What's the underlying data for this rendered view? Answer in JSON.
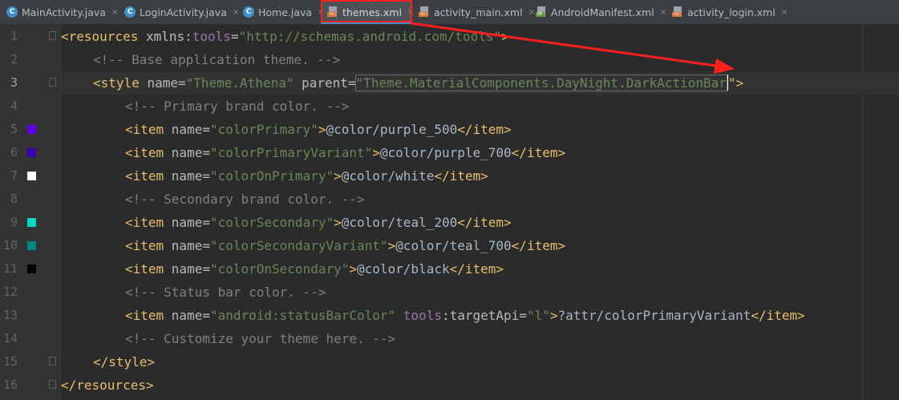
{
  "tabs": [
    {
      "label": "MainActivity.java",
      "icon": "java-class-icon",
      "active": false
    },
    {
      "label": "LoginActivity.java",
      "icon": "java-class-icon",
      "active": false
    },
    {
      "label": "Home.java",
      "icon": "java-class-icon",
      "active": false
    },
    {
      "label": "themes.xml",
      "icon": "xml-file-icon",
      "active": true
    },
    {
      "label": "activity_main.xml",
      "icon": "xml-file-icon",
      "active": false
    },
    {
      "label": "AndroidManifest.xml",
      "icon": "manifest-file-icon",
      "active": false
    },
    {
      "label": "activity_login.xml",
      "icon": "xml-file-icon",
      "active": false
    }
  ],
  "tab_close_glyph": "×",
  "java_icon_letter": "C",
  "xml_icon_tag": "<>",
  "manifest_icon_tag": "MF",
  "editor": {
    "current_line": 3,
    "line_numbers": [
      "1",
      "2",
      "3",
      "4",
      "5",
      "6",
      "7",
      "8",
      "9",
      "10",
      "11",
      "12",
      "13",
      "14",
      "15",
      "16"
    ],
    "swatches": [
      {
        "line": 5,
        "color": "#6200ee"
      },
      {
        "line": 6,
        "color": "#3700b3"
      },
      {
        "line": 7,
        "color": "#ffffff"
      },
      {
        "line": 9,
        "color": "#03dac5"
      },
      {
        "line": 10,
        "color": "#018786"
      },
      {
        "line": 11,
        "color": "#000000"
      }
    ],
    "lines": {
      "l1": {
        "open": "<resources ",
        "ns_attr": "xmlns:",
        "ns_name": "tools",
        "eq": "=",
        "value": "\"http://schemas.android.com/tools\"",
        "close": ">"
      },
      "l2": {
        "comment": "<!-- Base application theme. -->"
      },
      "l3": {
        "open": "<style ",
        "attr1": "name",
        "eq1": "=",
        "val1": "\"Theme.Athena\"",
        "attr2": "parent",
        "eq2": "=",
        "val2_a": "\"Theme.MaterialComponents.DayNight.DarkActionBar",
        "val2_b": "\"",
        "close": ">"
      },
      "l4": {
        "comment": "<!-- Primary brand color. -->"
      },
      "l5": {
        "open": "<item ",
        "attr": "name",
        "eq": "=",
        "value": "\"colorPrimary\"",
        "gt": ">",
        "text": "@color/purple_500",
        "close": "</item>"
      },
      "l6": {
        "open": "<item ",
        "attr": "name",
        "eq": "=",
        "value": "\"colorPrimaryVariant\"",
        "gt": ">",
        "text": "@color/purple_700",
        "close": "</item>"
      },
      "l7": {
        "open": "<item ",
        "attr": "name",
        "eq": "=",
        "value": "\"colorOnPrimary\"",
        "gt": ">",
        "text": "@color/white",
        "close": "</item>"
      },
      "l8": {
        "comment": "<!-- Secondary brand color. -->"
      },
      "l9": {
        "open": "<item ",
        "attr": "name",
        "eq": "=",
        "value": "\"colorSecondary\"",
        "gt": ">",
        "text": "@color/teal_200",
        "close": "</item>"
      },
      "l10": {
        "open": "<item ",
        "attr": "name",
        "eq": "=",
        "value": "\"colorSecondaryVariant\"",
        "gt": ">",
        "text": "@color/teal_700",
        "close": "</item>"
      },
      "l11": {
        "open": "<item ",
        "attr": "name",
        "eq": "=",
        "value": "\"colorOnSecondary\"",
        "gt": ">",
        "text": "@color/black",
        "close": "</item>"
      },
      "l12": {
        "comment": "<!-- Status bar color. -->"
      },
      "l13": {
        "open": "<item ",
        "attr": "name",
        "eq": "=",
        "value": "\"android:statusBarColor\"",
        "ns": "tools",
        "colon": ":",
        "attr2": "targetApi",
        "eq2": "=",
        "val2": "\"l\"",
        "gt": ">",
        "text": "?attr/colorPrimaryVariant",
        "close": "</item>"
      },
      "l14": {
        "comment": "<!-- Customize your theme here. -->"
      },
      "l15": {
        "text": "</style>"
      },
      "l16": {
        "text": "</resources>"
      }
    }
  },
  "colors": {
    "annotation": "#ff1f1f",
    "tag": "#e8bf6a",
    "attr_value": "#6a8759",
    "comment": "#808080"
  }
}
